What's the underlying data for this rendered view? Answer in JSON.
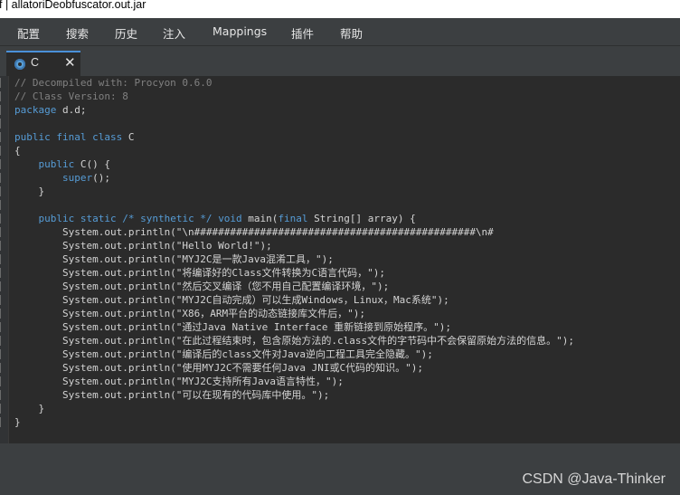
{
  "window": {
    "title": "f | allatoriDeobfuscator.out.jar"
  },
  "menu": {
    "items": [
      "配置",
      "搜索",
      "历史",
      "注入",
      "Mappings",
      "插件",
      "帮助"
    ]
  },
  "tab": {
    "label": "C",
    "close_glyph": "✕"
  },
  "code": {
    "lines": [
      [
        [
          "cm",
          "// Decompiled with: Procyon 0.6.0"
        ]
      ],
      [
        [
          "cm",
          "// Class Version: 8"
        ]
      ],
      [
        [
          "kw",
          "package"
        ],
        [
          "txt",
          " d.d;"
        ]
      ],
      [],
      [
        [
          "kw",
          "public final class"
        ],
        [
          "txt",
          " C"
        ]
      ],
      [
        [
          "txt",
          "{"
        ]
      ],
      [
        [
          "txt",
          "    "
        ],
        [
          "kw",
          "public"
        ],
        [
          "txt",
          " C() {"
        ]
      ],
      [
        [
          "txt",
          "        "
        ],
        [
          "kw",
          "super"
        ],
        [
          "txt",
          "();"
        ]
      ],
      [
        [
          "txt",
          "    }"
        ]
      ],
      [],
      [
        [
          "txt",
          "    "
        ],
        [
          "kw",
          "public static"
        ],
        [
          "txt",
          " "
        ],
        [
          "kw",
          "/* synthetic */"
        ],
        [
          "txt",
          " "
        ],
        [
          "kw",
          "void"
        ],
        [
          "txt",
          " main("
        ],
        [
          "kw",
          "final"
        ],
        [
          "txt",
          " String[] array) {"
        ]
      ],
      [
        [
          "txt",
          "        System.out.println(\"\\n###############################################\\n#"
        ]
      ],
      [
        [
          "txt",
          "        System.out.println(\"Hello World!\");"
        ]
      ],
      [
        [
          "txt",
          "        System.out.println(\"MYJ2C是一款Java混淆工具，\");"
        ]
      ],
      [
        [
          "txt",
          "        System.out.println(\"将编译好的Class文件转换为C语言代码，\");"
        ]
      ],
      [
        [
          "txt",
          "        System.out.println(\"然后交叉编译（您不用自己配置编译环境，\");"
        ]
      ],
      [
        [
          "txt",
          "        System.out.println(\"MYJ2C自动完成）可以生成Windows，Linux，Mac系统\");"
        ]
      ],
      [
        [
          "txt",
          "        System.out.println(\"X86，ARM平台的动态链接库文件后，\");"
        ]
      ],
      [
        [
          "txt",
          "        System.out.println(\"通过Java Native Interface 重新链接到原始程序。\");"
        ]
      ],
      [
        [
          "txt",
          "        System.out.println(\"在此过程结束时，包含原始方法的.class文件的字节码中不会保留原始方法的信息。\");"
        ]
      ],
      [
        [
          "txt",
          "        System.out.println(\"编译后的class文件对Java逆向工程工具完全隐藏。\");"
        ]
      ],
      [
        [
          "txt",
          "        System.out.println(\"使用MYJ2C不需要任何Java JNI或C代码的知识。\");"
        ]
      ],
      [
        [
          "txt",
          "        System.out.println(\"MYJ2C支持所有Java语言特性，\");"
        ]
      ],
      [
        [
          "txt",
          "        System.out.println(\"可以在现有的代码库中使用。\");"
        ]
      ],
      [
        [
          "txt",
          "    }"
        ]
      ],
      [
        [
          "txt",
          "}"
        ]
      ]
    ]
  },
  "watermark": {
    "text": "CSDN @Java-Thinker"
  },
  "colors": {
    "keyword": "#569cd6",
    "comment": "#808080",
    "text": "#d4d4d4",
    "background": "#2b2b2b",
    "chrome": "#3c3f41"
  },
  "icons": {
    "tab": "class-file-icon",
    "close": "close-icon"
  }
}
